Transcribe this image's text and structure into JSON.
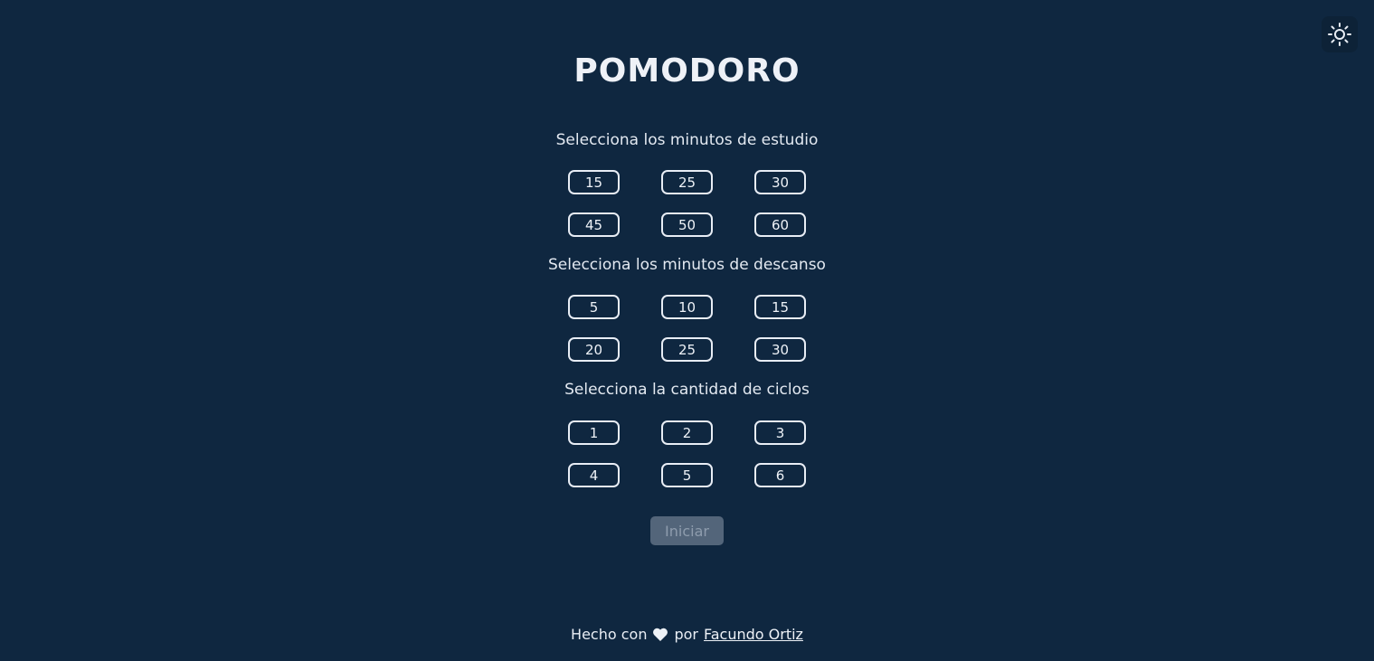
{
  "header": {
    "title": "POMODORO",
    "theme_toggle_icon": "sun-icon"
  },
  "study": {
    "label": "Selecciona los minutos de estudio",
    "options": [
      "15",
      "25",
      "30",
      "45",
      "50",
      "60"
    ]
  },
  "rest": {
    "label": "Selecciona los minutos de descanso",
    "options": [
      "5",
      "10",
      "15",
      "20",
      "25",
      "30"
    ]
  },
  "cycles": {
    "label": "Selecciona la cantidad de ciclos",
    "options": [
      "1",
      "2",
      "3",
      "4",
      "5",
      "6"
    ]
  },
  "start_button": {
    "label": "Iniciar",
    "state": "disabled"
  },
  "footer": {
    "prefix": "Hecho con",
    "heart_icon": "heart-icon",
    "middle": "por",
    "author": "Facundo Ortiz"
  },
  "colors": {
    "background": "#0f2740",
    "text": "#e9eef5",
    "button_border": "#e8edf5",
    "start_disabled_bg": "#53657a",
    "start_disabled_text": "#8e9cad"
  }
}
